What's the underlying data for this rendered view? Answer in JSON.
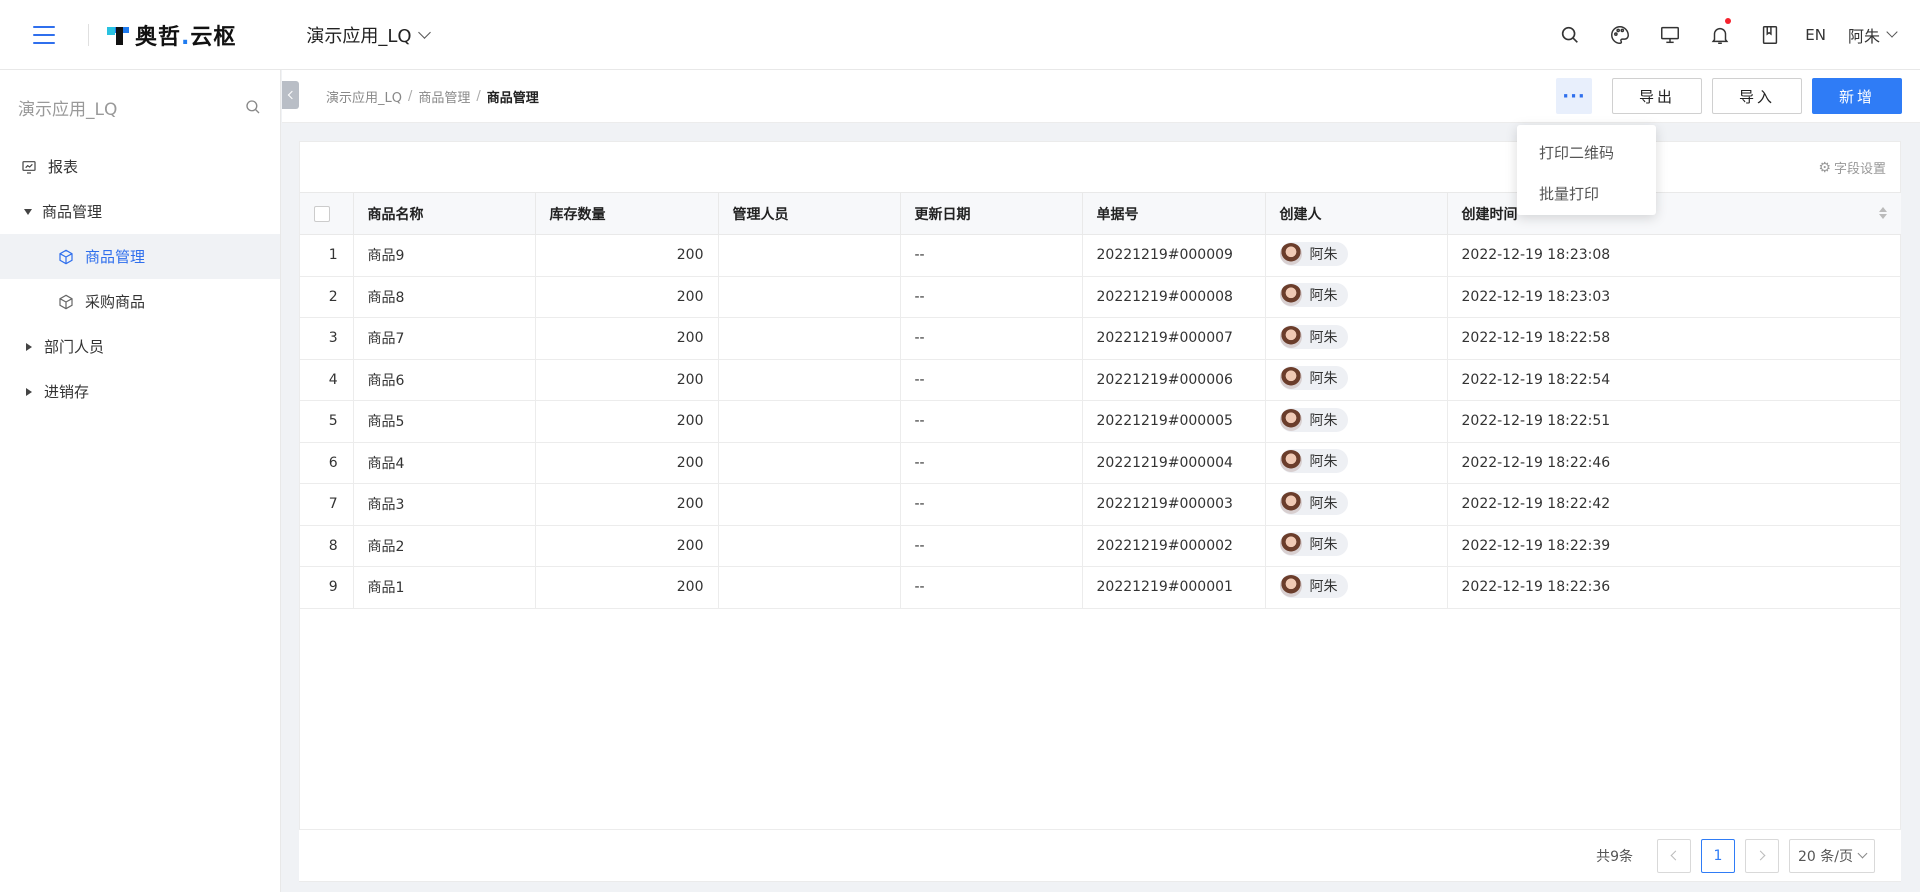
{
  "header": {
    "logo_text": "奥哲",
    "logo_dot": ".",
    "logo_text2": "云枢",
    "app_name": "演示应用_LQ",
    "lang": "EN",
    "user": "阿朱"
  },
  "sidebar": {
    "title": "演示应用_LQ",
    "items": [
      {
        "label": "报表"
      },
      {
        "label": "商品管理"
      },
      {
        "label": "商品管理"
      },
      {
        "label": "采购商品"
      },
      {
        "label": "部门人员"
      },
      {
        "label": "进销存"
      }
    ]
  },
  "breadcrumb": {
    "items": [
      "演示应用_LQ",
      "商品管理"
    ],
    "current": "商品管理",
    "sep": "/"
  },
  "toolbar": {
    "more": "···",
    "export": "导出",
    "import": "导入",
    "add": "新增"
  },
  "dropdown": {
    "items": [
      "打印二维码",
      "批量打印"
    ]
  },
  "table": {
    "field_settings": "字段设置",
    "columns": [
      "商品名称",
      "库存数量",
      "管理人员",
      "更新日期",
      "单据号",
      "创建人",
      "创建时间"
    ],
    "rows": [
      {
        "idx": "1",
        "name": "商品9",
        "qty": "200",
        "manager": "",
        "updated": "--",
        "doc": "20221219#000009",
        "creator": "阿朱",
        "created": "2022-12-19 18:23:08"
      },
      {
        "idx": "2",
        "name": "商品8",
        "qty": "200",
        "manager": "",
        "updated": "--",
        "doc": "20221219#000008",
        "creator": "阿朱",
        "created": "2022-12-19 18:23:03"
      },
      {
        "idx": "3",
        "name": "商品7",
        "qty": "200",
        "manager": "",
        "updated": "--",
        "doc": "20221219#000007",
        "creator": "阿朱",
        "created": "2022-12-19 18:22:58"
      },
      {
        "idx": "4",
        "name": "商品6",
        "qty": "200",
        "manager": "",
        "updated": "--",
        "doc": "20221219#000006",
        "creator": "阿朱",
        "created": "2022-12-19 18:22:54"
      },
      {
        "idx": "5",
        "name": "商品5",
        "qty": "200",
        "manager": "",
        "updated": "--",
        "doc": "20221219#000005",
        "creator": "阿朱",
        "created": "2022-12-19 18:22:51"
      },
      {
        "idx": "6",
        "name": "商品4",
        "qty": "200",
        "manager": "",
        "updated": "--",
        "doc": "20221219#000004",
        "creator": "阿朱",
        "created": "2022-12-19 18:22:46"
      },
      {
        "idx": "7",
        "name": "商品3",
        "qty": "200",
        "manager": "",
        "updated": "--",
        "doc": "20221219#000003",
        "creator": "阿朱",
        "created": "2022-12-19 18:22:42"
      },
      {
        "idx": "8",
        "name": "商品2",
        "qty": "200",
        "manager": "",
        "updated": "--",
        "doc": "20221219#000002",
        "creator": "阿朱",
        "created": "2022-12-19 18:22:39"
      },
      {
        "idx": "9",
        "name": "商品1",
        "qty": "200",
        "manager": "",
        "updated": "--",
        "doc": "20221219#000001",
        "creator": "阿朱",
        "created": "2022-12-19 18:22:36"
      }
    ]
  },
  "pagination": {
    "total": "共9条",
    "current_page": "1",
    "page_size": "20 条/页"
  },
  "colors": {
    "accent": "#2f7cf6",
    "active_bg": "#f0f2f5"
  }
}
